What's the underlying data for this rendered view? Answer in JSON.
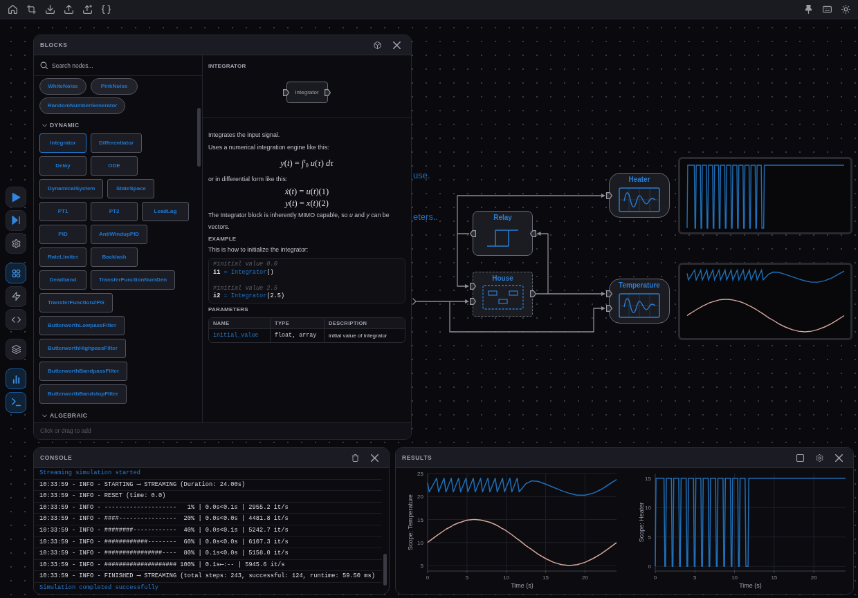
{
  "left_toolbar": [
    [
      {
        "on": false
      },
      {
        "on": false
      },
      {
        "on": false
      }
    ],
    [
      {
        "on": true
      },
      {
        "on": false
      },
      {
        "on": false
      }
    ],
    [
      {
        "on": false
      }
    ],
    [
      {
        "on": true
      },
      {
        "on": true
      }
    ]
  ],
  "canvas_texts": [
    "use.",
    "eters.."
  ],
  "diagram": {
    "nodes": [
      {
        "label": "Relay",
        "kind": "relay"
      },
      {
        "label": "House",
        "kind": "subsystem"
      },
      {
        "label": "Heater",
        "kind": "scope"
      },
      {
        "label": "Temperature",
        "kind": "scope"
      }
    ]
  },
  "blocks_panel": {
    "title": "BLOCKS",
    "search": {
      "placeholder": "Search nodes..."
    },
    "groups": [
      {
        "rows": [
          [
            {
              "label": "WhiteNoise",
              "kind": "source",
              "selected": false
            },
            {
              "label": "PinkNoise",
              "kind": "source",
              "selected": false
            }
          ],
          [
            {
              "label": "RandomNumberGenerator",
              "kind": "source",
              "selected": false
            }
          ]
        ]
      },
      {
        "title": "DYNAMIC",
        "expanded": true,
        "rows": [
          [
            {
              "label": "Integrator",
              "kind": "block",
              "selected": true
            },
            {
              "label": "Differentiator",
              "kind": "block",
              "selected": false
            }
          ],
          [
            {
              "label": "Delay",
              "kind": "block",
              "selected": false
            },
            {
              "label": "ODE",
              "kind": "block",
              "selected": false
            }
          ],
          [
            {
              "label": "DynamicalSystem",
              "kind": "block",
              "selected": false
            },
            {
              "label": "StateSpace",
              "kind": "block",
              "selected": false
            }
          ],
          [
            {
              "label": "PT1",
              "kind": "block",
              "selected": false
            },
            {
              "label": "PT2",
              "kind": "block",
              "selected": false
            },
            {
              "label": "LeadLag",
              "kind": "block",
              "selected": false
            }
          ],
          [
            {
              "label": "PID",
              "kind": "block",
              "selected": false
            },
            {
              "label": "AntiWindupPID",
              "kind": "block",
              "selected": false
            }
          ],
          [
            {
              "label": "RateLimiter",
              "kind": "block",
              "selected": false
            },
            {
              "label": "Backlash",
              "kind": "block",
              "selected": false
            }
          ],
          [
            {
              "label": "Deadband",
              "kind": "block",
              "selected": false
            },
            {
              "label": "TransferFunctionNumDen",
              "kind": "block",
              "selected": false
            }
          ],
          [
            {
              "label": "TransferFunctionZPG",
              "kind": "block",
              "selected": false
            }
          ],
          [
            {
              "label": "ButterworthLowpassFilter",
              "kind": "block",
              "selected": false
            }
          ],
          [
            {
              "label": "ButterworthHighpassFilter",
              "kind": "block",
              "selected": false
            }
          ],
          [
            {
              "label": "ButterworthBandpassFilter",
              "kind": "block",
              "selected": false
            }
          ],
          [
            {
              "label": "ButterworthBandstopFilter",
              "kind": "block",
              "selected": false
            }
          ]
        ]
      },
      {
        "title": "ALGEBRAIC",
        "expanded": true
      }
    ],
    "doc": {
      "title": "INTEGRATOR",
      "preview": {
        "label": "Integrator"
      },
      "content": [
        {
          "kind": "text",
          "text": "Integrates the input signal."
        },
        {
          "kind": "text",
          "text": "Uses a numerical integration engine like this:"
        },
        {
          "kind": "formula",
          "lines": [
            "*y*(*t*) = ∫$^{t}$$_{0}$ *u*(*τ*) *dτ*"
          ]
        },
        {
          "kind": "text",
          "text": "or in differential form like this:"
        },
        {
          "kind": "formula",
          "lines": [
            "*ẋ*(*t*) = *u*(*t*)(1)",
            "*y*(*t*) = *x*(*t*)(2)"
          ]
        },
        {
          "kind": "text",
          "text": "The Integrator block is inherently MIMO capable, so *u* and *y* can be vectors."
        },
        {
          "kind": "heading",
          "text": "EXAMPLE"
        },
        {
          "kind": "text",
          "text": "This is how to initialize the integrator:"
        },
        {
          "kind": "code",
          "snippets": [
            {
              "comment": "#initial value 0.0",
              "tokens": [
                {
                  "kind": "name",
                  "text": "i1"
                },
                {
                  "kind": "operator",
                  "text": " = "
                },
                {
                  "kind": "call",
                  "text": "Integrator"
                },
                {
                  "kind": "plain",
                  "text": "()"
                }
              ]
            },
            {
              "comment": "#initial value 2.5",
              "tokens": [
                {
                  "kind": "name",
                  "text": "i2"
                },
                {
                  "kind": "operator",
                  "text": " = "
                },
                {
                  "kind": "call",
                  "text": "Integrator"
                },
                {
                  "kind": "plain",
                  "text": "(2.5)"
                }
              ]
            }
          ]
        },
        {
          "kind": "heading",
          "text": "PARAMETERS"
        },
        {
          "kind": "table",
          "columns": [
            "NAME",
            "TYPE",
            "DESCRIPTION"
          ],
          "rows": [
            [
              "initial_value",
              "float, array",
              "initial value of integrator"
            ]
          ]
        }
      ]
    },
    "footer": "Click or drag to add"
  },
  "console": {
    "title": "CONSOLE",
    "lines": [
      {
        "kind": "status",
        "text": "Streaming simulation started"
      },
      {
        "kind": "log",
        "text": "10:33:59 - INFO - STARTING ⟶ STREAMING (Duration: 24.00s)"
      },
      {
        "kind": "log",
        "text": "10:33:59 - INFO - RESET (time: 0.0)"
      },
      {
        "kind": "log",
        "text": "10:33:59 - INFO - --------------------   1% | 0.0s<0.1s | 2955.2 it/s"
      },
      {
        "kind": "log",
        "text": "10:33:59 - INFO - ####----------------  20% | 0.0s<0.0s | 4481.8 it/s"
      },
      {
        "kind": "log",
        "text": "10:33:59 - INFO - ########------------  40% | 0.0s<0.1s | 5242.7 it/s"
      },
      {
        "kind": "log",
        "text": "10:33:59 - INFO - ############--------  60% | 0.0s<0.0s | 6107.3 it/s"
      },
      {
        "kind": "log",
        "text": "10:33:59 - INFO - ################----  80% | 0.1s<0.0s | 5158.0 it/s"
      },
      {
        "kind": "log",
        "text": "10:33:59 - INFO - #################### 100% | 0.1s⟵:-- | 5945.6 it/s"
      },
      {
        "kind": "log",
        "text": "10:33:59 - INFO - FINISHED ⟶ STREAMING (total steps: 243, successful: 124, runtime: 59.50 ms)"
      },
      {
        "kind": "status",
        "text": "Simulation completed successfully"
      }
    ]
  },
  "results": {
    "title": "RESULTS",
    "charts": [
      {
        "chart_data": {
          "type": "line",
          "xlabel": "Time (s)",
          "ylabel": "Scope: Temperature",
          "grid": true,
          "x": [
            0,
            0.2,
            1.15,
            1.4,
            2.08,
            2.33,
            3.01,
            3.26,
            3.94,
            4.19,
            4.87,
            5.12,
            5.8,
            6.05,
            6.73,
            6.98,
            7.66,
            7.91,
            8.59,
            8.84,
            9.52,
            9.77,
            10.45,
            10.7,
            11.38,
            11.63,
            12.5,
            13.2,
            14,
            15,
            16,
            17,
            18,
            19,
            20,
            21,
            22,
            23,
            24
          ],
          "series": [
            {
              "color": "#1f6fb8",
              "values": [
                23,
                21,
                24,
                21,
                24,
                21,
                24,
                21,
                24,
                21,
                24,
                21,
                24,
                21,
                24,
                21,
                24,
                21,
                24,
                21,
                24,
                21,
                24,
                21,
                24,
                21,
                22.8,
                23.4,
                23.3,
                22.7,
                22,
                21.3,
                20.7,
                20.3,
                20.3,
                20.7,
                21.5,
                22.6,
                23.7
              ]
            },
            {
              "color": "#d6a89c",
              "values": [
                10,
                10.3,
                11.5,
                11.8,
                12.6,
                12.9,
                13.5,
                13.8,
                14.3,
                14.4,
                14.8,
                14.9,
                15,
                15,
                14.9,
                14.8,
                14.5,
                14.4,
                13.9,
                13.7,
                13,
                12.8,
                12,
                11.7,
                10.8,
                10.5,
                9.3,
                8.5,
                7.5,
                6.5,
                5.7,
                5.2,
                5,
                5.2,
                5.7,
                6.5,
                7.5,
                8.7,
                10
              ]
            }
          ],
          "xlim": [
            0,
            24
          ],
          "ylim": [
            3.8,
            25
          ],
          "xticks": [
            0,
            5,
            10,
            15,
            20
          ],
          "yticks": [
            5,
            10,
            15,
            20,
            25
          ]
        }
      },
      {
        "chart_data": {
          "type": "line",
          "xlabel": "Time (s)",
          "ylabel": "Scope: Heater",
          "grid": true,
          "x": [
            0,
            0.1,
            1.1,
            1.2,
            1.3,
            1.4,
            2.03,
            2.13,
            2.23,
            2.33,
            2.96,
            3.06,
            3.16,
            3.26,
            3.89,
            3.99,
            4.09,
            4.19,
            4.82,
            4.92,
            5.02,
            5.12,
            5.75,
            5.85,
            5.95,
            6.05,
            6.68,
            6.78,
            6.88,
            6.98,
            7.61,
            7.71,
            7.81,
            7.91,
            8.54,
            8.64,
            8.74,
            8.84,
            9.47,
            9.57,
            9.67,
            9.77,
            10.4,
            10.5,
            10.6,
            10.7,
            11.33,
            11.43,
            11.7,
            11.8,
            24
          ],
          "series": [
            {
              "color": "#1f6fb8",
              "values": [
                0,
                15,
                15,
                0,
                0,
                15,
                15,
                0,
                0,
                15,
                15,
                0,
                0,
                15,
                15,
                0,
                0,
                15,
                15,
                0,
                0,
                15,
                15,
                0,
                0,
                15,
                15,
                0,
                0,
                15,
                15,
                0,
                0,
                15,
                15,
                0,
                0,
                15,
                15,
                0,
                0,
                15,
                15,
                0,
                0,
                15,
                15,
                0,
                0,
                15,
                15
              ]
            }
          ],
          "xlim": [
            0,
            24
          ],
          "ylim": [
            -0.8,
            15.8
          ],
          "xticks": [
            0,
            5,
            10,
            15,
            20
          ],
          "yticks": [
            0,
            5,
            10,
            15
          ]
        }
      }
    ]
  }
}
